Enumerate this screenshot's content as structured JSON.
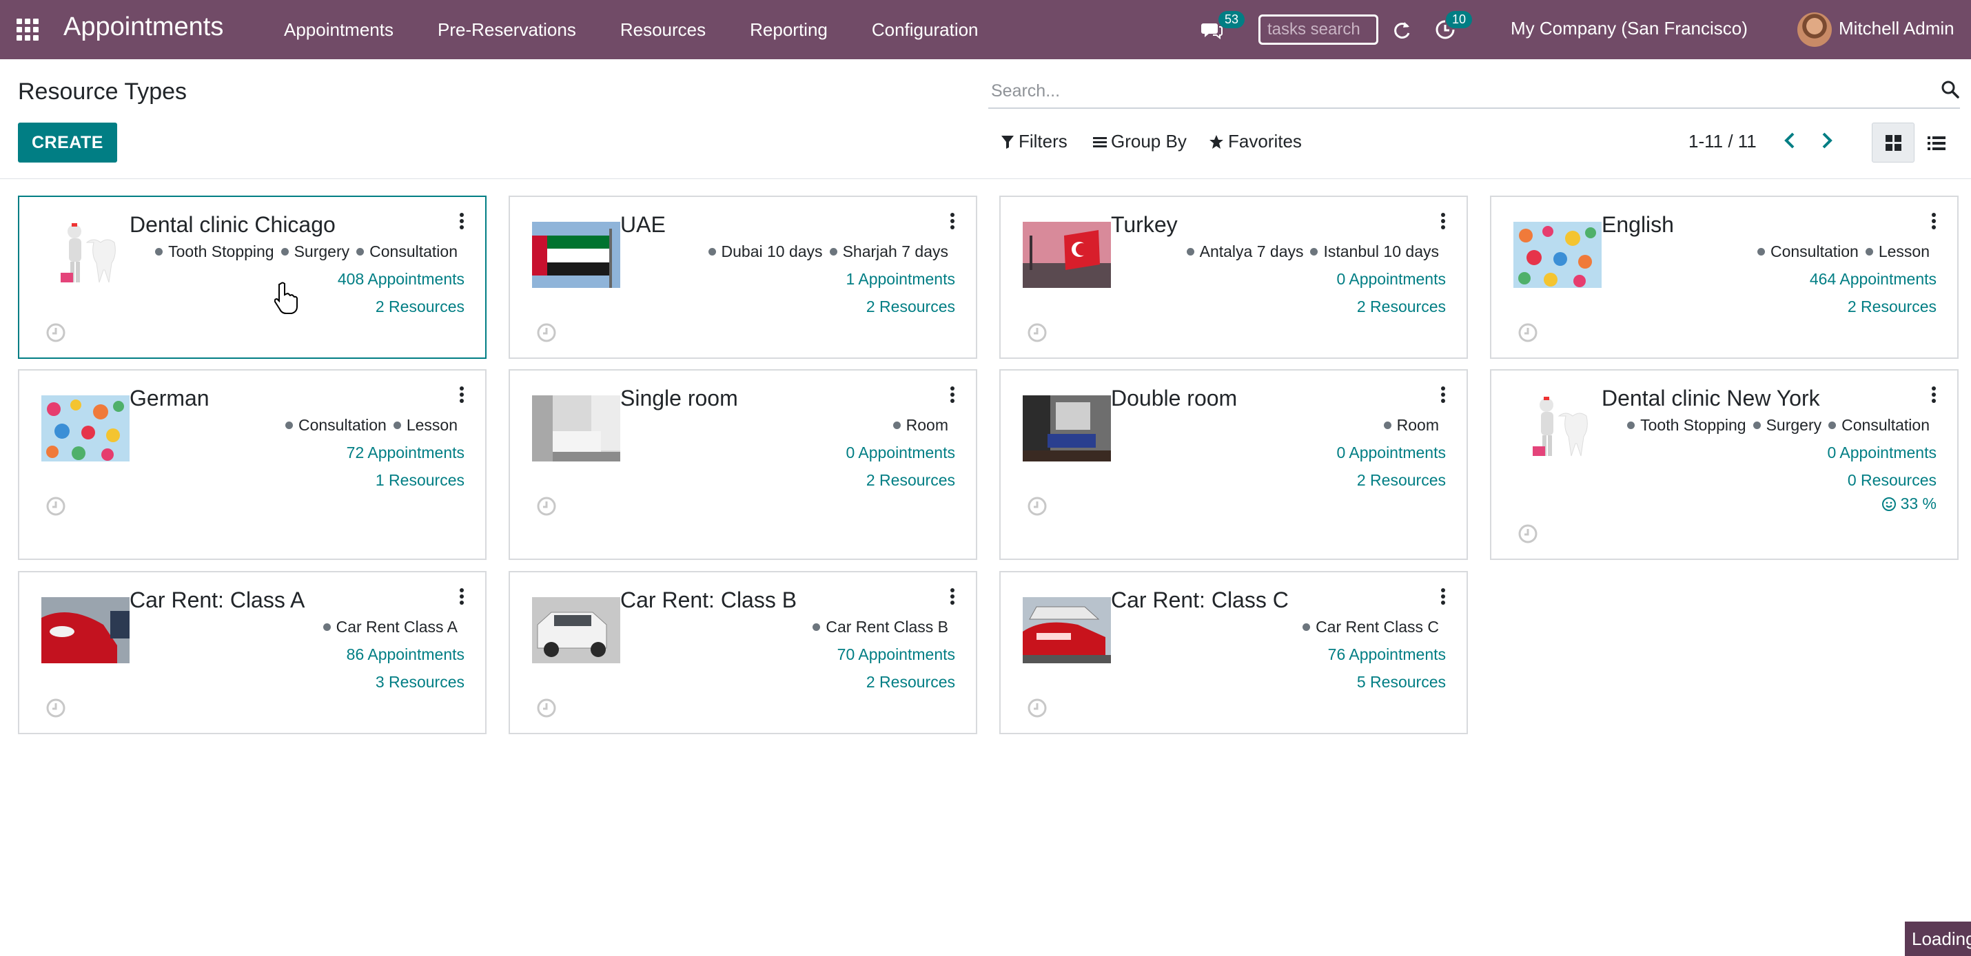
{
  "navbar": {
    "brand": "Appointments",
    "menu": [
      {
        "label": "Appointments"
      },
      {
        "label": "Pre-Reservations"
      },
      {
        "label": "Resources"
      },
      {
        "label": "Reporting"
      },
      {
        "label": "Configuration"
      }
    ],
    "messages_badge": "53",
    "tasks_search_placeholder": "tasks search",
    "activities_badge": "10",
    "company": "My Company (San Francisco)",
    "user_name": "Mitchell Admin"
  },
  "control_panel": {
    "title": "Resource Types",
    "create_label": "CREATE",
    "search_placeholder": "Search...",
    "filters_label": "Filters",
    "group_by_label": "Group By",
    "favorites_label": "Favorites",
    "pager": "1-11 / 11"
  },
  "cards": [
    {
      "title": "Dental clinic Chicago",
      "image": "dentist-tooth-figure",
      "tags": [
        "Tooth Stopping",
        "Surgery",
        "Consultation"
      ],
      "appointments": "408 Appointments",
      "resources": "2 Resources",
      "selected": true
    },
    {
      "title": "UAE",
      "image": "uae-flag",
      "tags": [
        "Dubai 10 days",
        "Sharjah 7 days"
      ],
      "appointments": "1 Appointments",
      "resources": "2 Resources"
    },
    {
      "title": "Turkey",
      "image": "turkey-flag-mosque",
      "tags": [
        "Antalya 7 days",
        "Istanbul 10 days"
      ],
      "appointments": "0 Appointments",
      "resources": "2 Resources"
    },
    {
      "title": "English",
      "image": "alphabet-letters",
      "tags": [
        "Consultation",
        "Lesson"
      ],
      "appointments": "464 Appointments",
      "resources": "2 Resources"
    },
    {
      "title": "German",
      "image": "alphabet-letters",
      "tags": [
        "Consultation",
        "Lesson"
      ],
      "appointments": "72 Appointments",
      "resources": "1 Resources"
    },
    {
      "title": "Single room",
      "image": "single-room",
      "tags": [
        "Room"
      ],
      "appointments": "0 Appointments",
      "resources": "2 Resources"
    },
    {
      "title": "Double room",
      "image": "double-room",
      "tags": [
        "Room"
      ],
      "appointments": "0 Appointments",
      "resources": "2 Resources"
    },
    {
      "title": "Dental clinic New York",
      "image": "dentist-tooth-figure",
      "tags": [
        "Tooth Stopping",
        "Surgery",
        "Consultation"
      ],
      "appointments": "0 Appointments",
      "resources": "0 Resources",
      "rating": "33 %"
    },
    {
      "title": "Car Rent: Class A",
      "image": "red-car",
      "tags": [
        "Car Rent Class A"
      ],
      "appointments": "86 Appointments",
      "resources": "3 Resources"
    },
    {
      "title": "Car Rent: Class B",
      "image": "white-suv",
      "tags": [
        "Car Rent Class B"
      ],
      "appointments": "70 Appointments",
      "resources": "2 Resources"
    },
    {
      "title": "Car Rent: Class C",
      "image": "red-cars-lot",
      "tags": [
        "Car Rent Class C"
      ],
      "appointments": "76 Appointments",
      "resources": "5 Resources"
    }
  ],
  "status": {
    "loading": "Loading"
  },
  "colors": {
    "navbar": "#714b67",
    "primary": "#017e84",
    "selected_border": "#017e84"
  }
}
